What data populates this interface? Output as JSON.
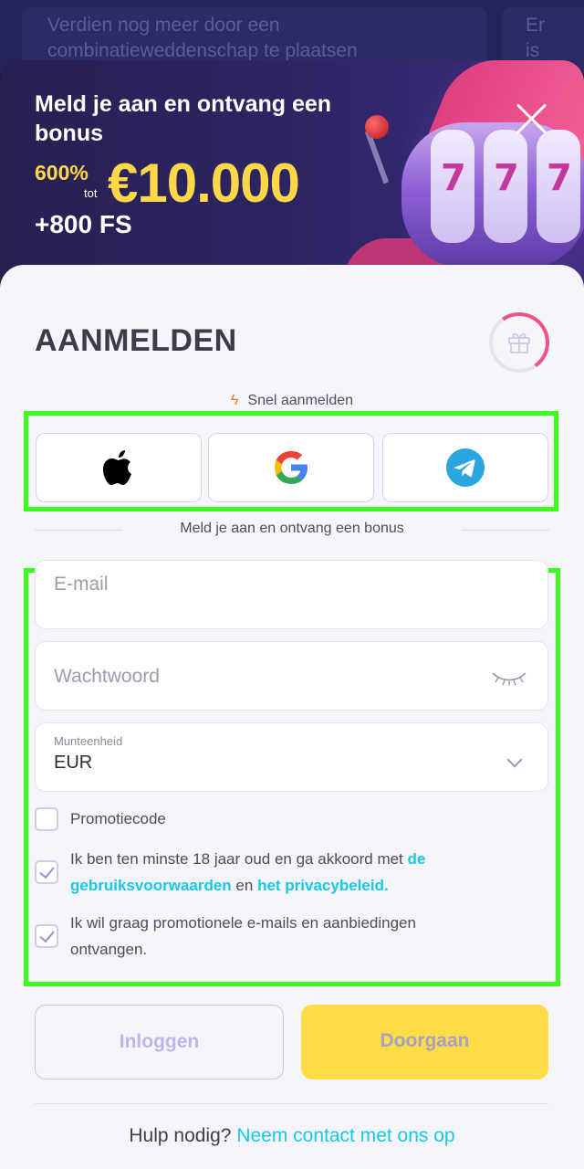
{
  "background": {
    "promo_text_left": "Verdien nog meer door een combinatieweddenschap te plaatsen",
    "promo_text_right": "Er is raki"
  },
  "banner": {
    "title": "Meld je aan en ontvang een bonus",
    "bonus_percent": "600%",
    "bonus_tot": "tot",
    "bonus_amount": "€10.000",
    "bonus_fs": "+800 FS",
    "close_icon": "close-icon"
  },
  "signup": {
    "title": "AANMELDEN",
    "quick_label": "Snel aanmelden",
    "social": [
      "apple-icon",
      "google-icon",
      "telegram-icon"
    ],
    "divider_text": "Meld je aan en ontvang een bonus",
    "email_placeholder": "E-mail",
    "password_placeholder": "Wachtwoord",
    "currency_label": "Munteenheid",
    "currency_value": "EUR",
    "promo_label": "Promotiecode",
    "age_text": "Ik ben ten minste 18 jaar oud en ga akkoord met",
    "terms_link": "de gebruiksvoorwaarden",
    "and_text": "en",
    "privacy_link": "het privacybeleid.",
    "marketing_text": "Ik wil graag promotionele e-mails en aanbiedingen ontvangen.",
    "login_button": "Inloggen",
    "continue_button": "Doorgaan",
    "help_text": "Hulp nodig?",
    "contact_link": "Neem contact met ons op"
  },
  "colors": {
    "accent_yellow": "#ffdc47",
    "link_cyan": "#16c8e8",
    "highlight_green": "#3cff1e"
  }
}
